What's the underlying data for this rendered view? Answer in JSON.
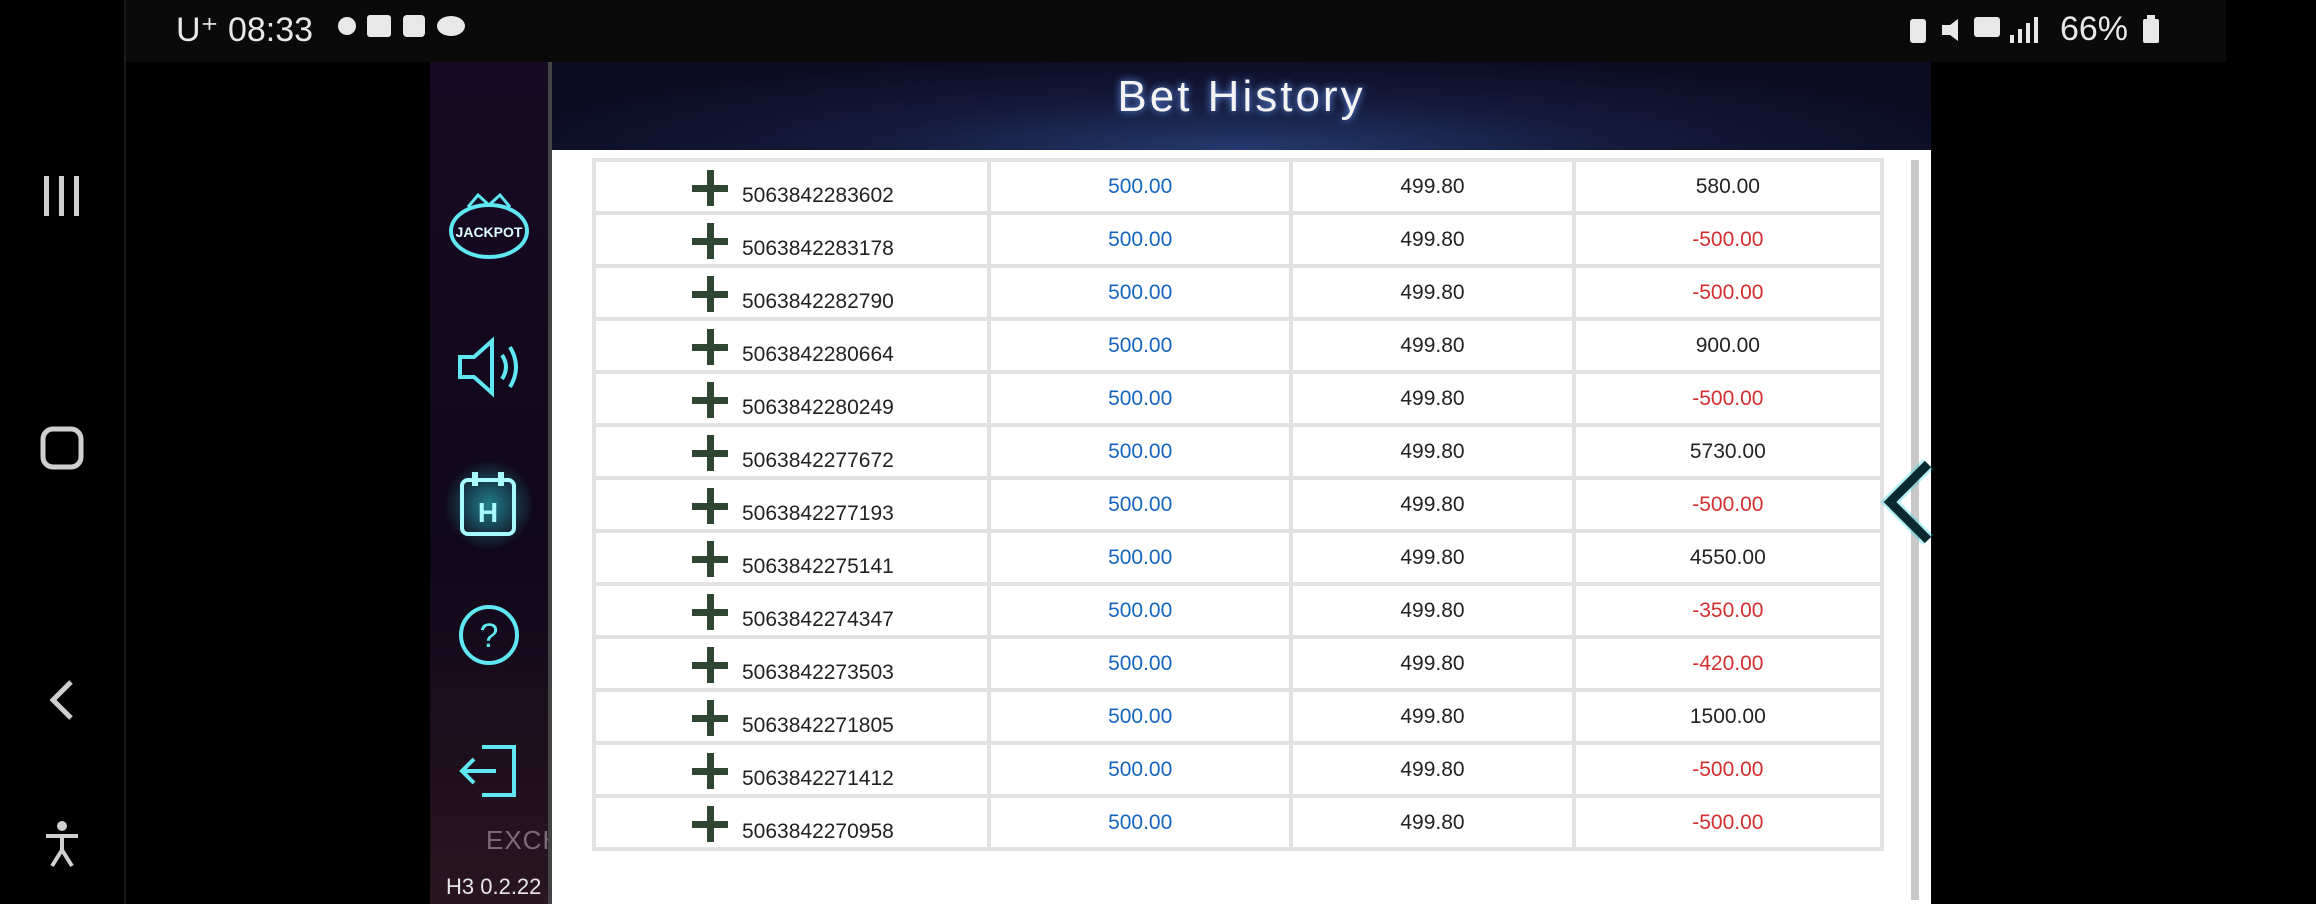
{
  "status_bar": {
    "carrier": "U⁺",
    "time": "08:33",
    "battery": "66%"
  },
  "game": {
    "version": "H3 0.2.22",
    "exchange_label": "EXCH",
    "side_icons": [
      "jackpot-icon",
      "sound-icon",
      "history-icon",
      "help-icon",
      "exit-icon"
    ],
    "jackpot_label": "JACKPOT"
  },
  "popup": {
    "title": "Bet History",
    "rows": [
      {
        "id": "5063842283602",
        "bet": "500.00",
        "valid": "499.80",
        "win": "580.00",
        "negative": false
      },
      {
        "id": "5063842283178",
        "bet": "500.00",
        "valid": "499.80",
        "win": "-500.00",
        "negative": true
      },
      {
        "id": "5063842282790",
        "bet": "500.00",
        "valid": "499.80",
        "win": "-500.00",
        "negative": true
      },
      {
        "id": "5063842280664",
        "bet": "500.00",
        "valid": "499.80",
        "win": "900.00",
        "negative": false
      },
      {
        "id": "5063842280249",
        "bet": "500.00",
        "valid": "499.80",
        "win": "-500.00",
        "negative": true
      },
      {
        "id": "5063842277672",
        "bet": "500.00",
        "valid": "499.80",
        "win": "5730.00",
        "negative": false
      },
      {
        "id": "5063842277193",
        "bet": "500.00",
        "valid": "499.80",
        "win": "-500.00",
        "negative": true
      },
      {
        "id": "5063842275141",
        "bet": "500.00",
        "valid": "499.80",
        "win": "4550.00",
        "negative": false
      },
      {
        "id": "5063842274347",
        "bet": "500.00",
        "valid": "499.80",
        "win": "-350.00",
        "negative": true
      },
      {
        "id": "5063842273503",
        "bet": "500.00",
        "valid": "499.80",
        "win": "-420.00",
        "negative": true
      },
      {
        "id": "5063842271805",
        "bet": "500.00",
        "valid": "499.80",
        "win": "1500.00",
        "negative": false
      },
      {
        "id": "5063842271412",
        "bet": "500.00",
        "valid": "499.80",
        "win": "-500.00",
        "negative": true
      },
      {
        "id": "5063842270958",
        "bet": "500.00",
        "valid": "499.80",
        "win": "-500.00",
        "negative": true
      }
    ]
  },
  "colors": {
    "bet_blue": "#1565c0",
    "negative_red": "#d32f2f",
    "accent_cyan": "#29d3e8"
  }
}
